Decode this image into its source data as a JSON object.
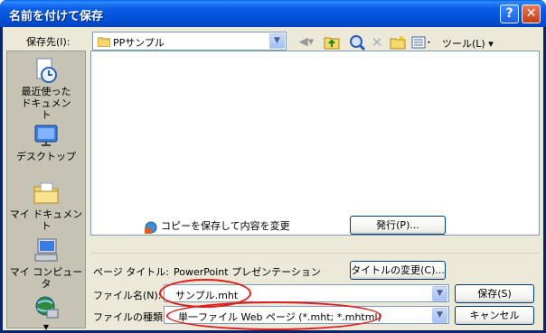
{
  "window": {
    "title": "名前を付けて保存",
    "help_glyph": "?",
    "close_glyph": "✕"
  },
  "location": {
    "label": "保存先(I):",
    "value": "PPサンプル"
  },
  "toolbar": {
    "tools_label": "ツール(L)",
    "tools_arrow": "▾"
  },
  "places": [
    {
      "label": "最近使ったドキュメント",
      "icon": "recent-documents-icon"
    },
    {
      "label": "デスクトップ",
      "icon": "desktop-icon"
    },
    {
      "label": "マイ ドキュメント",
      "icon": "my-documents-icon"
    },
    {
      "label": "マイ コンピュータ",
      "icon": "my-computer-icon"
    },
    {
      "label": "",
      "icon": "network-icon"
    }
  ],
  "copy_notice": "コピーを保存して内容を変更",
  "publish_button": "発行(P)...",
  "page_title": {
    "label": "ページ タイトル:",
    "value": "PowerPoint プレゼンテーション",
    "change_button": "タイトルの変更(C)..."
  },
  "filename": {
    "label": "ファイル名(N):",
    "value": "サンプル.mht"
  },
  "filetype": {
    "label": "ファイルの種類(T):",
    "value": "単一ファイル Web ページ (*.mht; *.mhtml)"
  },
  "save_button": "保存(S)",
  "cancel_button": "キャンセル",
  "colors": {
    "title_bar": "#0150d6",
    "dialog_face": "#ece9d8",
    "annotation_ring": "#e11c1c"
  }
}
